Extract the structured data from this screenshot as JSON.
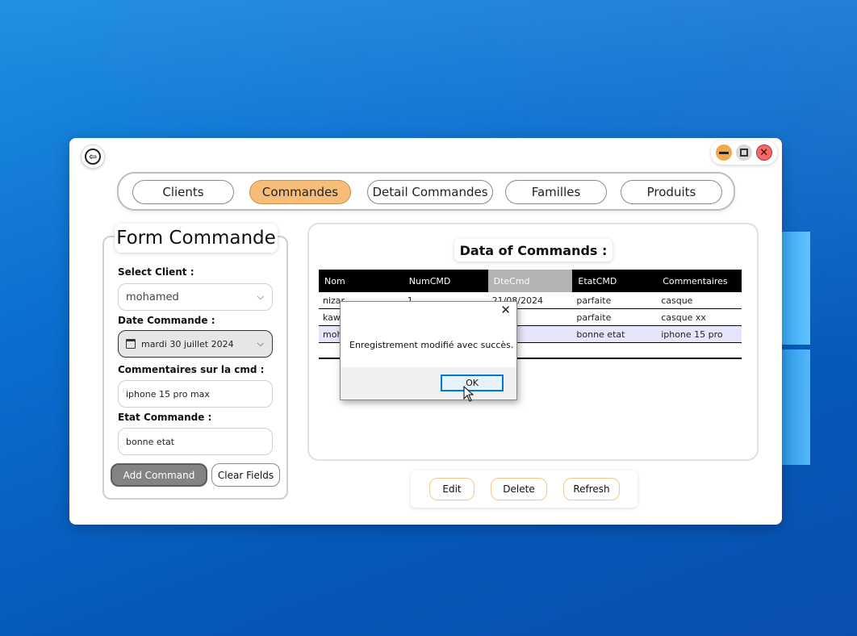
{
  "nav": {
    "tabs": [
      {
        "label": "Clients"
      },
      {
        "label": "Commandes"
      },
      {
        "label": "Detail Commandes"
      },
      {
        "label": "Familles"
      },
      {
        "label": "Produits"
      }
    ],
    "active": "Commandes"
  },
  "form": {
    "title": "Form Commande",
    "client_label": "Select Client :",
    "client_value": "mohamed",
    "date_label": "Date Commande :",
    "date_value": "mardi 30 juillet 2024",
    "comment_label": "Commentaires sur la cmd :",
    "comment_value": "iphone 15 pro max",
    "state_label": "Etat Commande :",
    "state_value": "bonne etat",
    "add_button": "Add Command",
    "clear_button": "Clear Fields"
  },
  "grid": {
    "title": "Data of Commands :",
    "columns": [
      "Nom",
      "NumCMD",
      "DteCmd",
      "EtatCMD",
      "Commentaires"
    ],
    "rows": [
      [
        "nizar",
        "1",
        "21/08/2024",
        "parfaite",
        "casque"
      ],
      [
        "kawa",
        "",
        "/2024",
        "parfaite",
        "casque xx"
      ],
      [
        "moha",
        "",
        "/2024",
        "bonne etat",
        "iphone 15 pro"
      ]
    ]
  },
  "actions": {
    "edit": "Edit",
    "delete": "Delete",
    "refresh": "Refresh"
  },
  "dialog": {
    "message": "Enregistrement modifié avec succès.",
    "ok": "OK",
    "close_glyph": "✕"
  },
  "icons": {
    "back": "back-arrow-icon",
    "minimize": "minimize-icon",
    "maximize": "maximize-icon",
    "close": "close-icon"
  },
  "colors": {
    "accent": "#f6bd78",
    "header": "#000000",
    "selected_row": "#e6e6fa",
    "ok_border": "#0078d7"
  }
}
